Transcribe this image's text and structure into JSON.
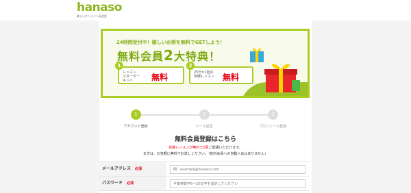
{
  "header": {
    "logo_text": "hanaso",
    "tagline": "楽しいオンライン英会話"
  },
  "banner": {
    "lead": "24時間受付中！嬉しいお得を無料でGETしよう！",
    "title": "無料会員",
    "title_big": "2",
    "title_suffix": "大特典！",
    "perks": [
      {
        "num": "1",
        "desc": "レッスン\nスターター\nキット",
        "free": "無料"
      },
      {
        "num": "2",
        "desc": "25分×2回の\n体験レッスン",
        "free": "無料"
      }
    ]
  },
  "steps": [
    {
      "num": "1",
      "label": "アカウント登録",
      "active": true
    },
    {
      "num": "2",
      "label": "メール認証",
      "active": false
    },
    {
      "num": "3",
      "label": "プロフィール登録",
      "active": false
    }
  ],
  "form": {
    "title": "無料会員登録はこちら",
    "note1_red": "体験レッスンが無料で2回",
    "note1_rest": "ご受講いただけます。",
    "note2": "まずは、お気軽に無料でお試しください。（有料会員への自動入会はありません）",
    "fields": [
      {
        "label": "メールアドレス",
        "required": "必須",
        "placeholder": "例：example@hanaso.com"
      },
      {
        "label": "パスワード",
        "required": "必須",
        "placeholder": "半角英数字6〜20文字を設定してください"
      }
    ]
  },
  "colors": {
    "brand_green": "#a9cd23",
    "required_red": "#e60012"
  }
}
